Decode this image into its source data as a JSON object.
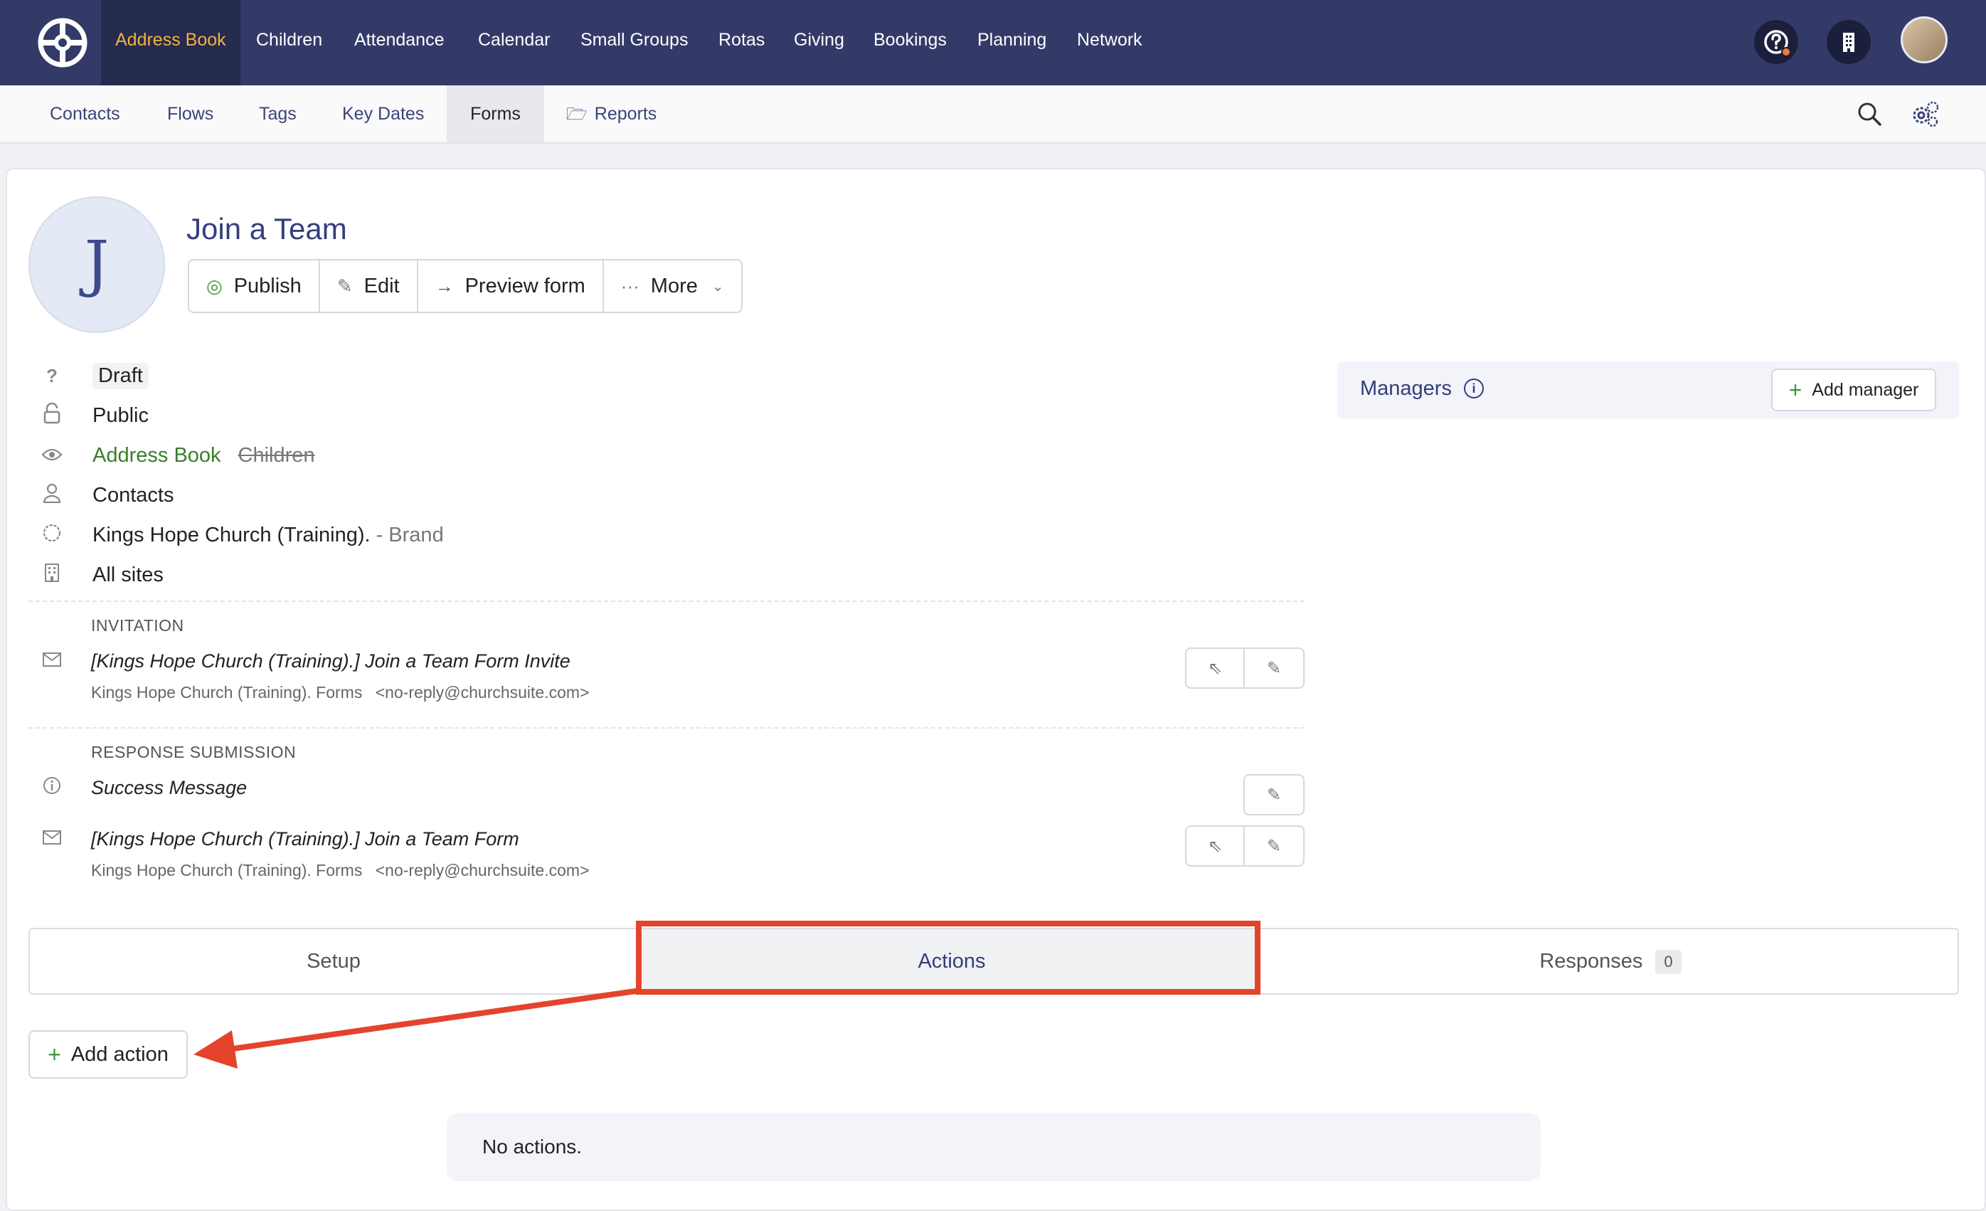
{
  "topnav": {
    "items": [
      "Address Book",
      "Children",
      "Attendance",
      "Calendar",
      "Small Groups",
      "Rotas",
      "Giving",
      "Bookings",
      "Planning",
      "Network"
    ]
  },
  "subnav": {
    "items": [
      "Contacts",
      "Flows",
      "Tags",
      "Key Dates",
      "Forms",
      "Reports"
    ]
  },
  "form": {
    "avatar_letter": "J",
    "title": "Join a Team",
    "buttons": {
      "publish": "Publish",
      "edit": "Edit",
      "preview": "Preview form",
      "more": "More"
    },
    "status": "Draft",
    "visibility": "Public",
    "modules": {
      "enabled": "Address Book",
      "disabled": "Children"
    },
    "audience": "Contacts",
    "brand_name": "Kings Hope Church (Training).",
    "brand_suffix": "- Brand",
    "sites": "All sites"
  },
  "invitation": {
    "label": "INVITATION",
    "subject": "[Kings Hope Church (Training).] Join a Team Form Invite",
    "from_name": "Kings Hope Church (Training). Forms",
    "from_email": "<no-reply@churchsuite.com>"
  },
  "response": {
    "label": "RESPONSE SUBMISSION",
    "success": "Success Message",
    "subject": "[Kings Hope Church (Training).] Join a Team Form",
    "from_name": "Kings Hope Church (Training). Forms",
    "from_email": "<no-reply@churchsuite.com>"
  },
  "managers": {
    "label": "Managers",
    "add": "Add manager"
  },
  "tabs": {
    "setup": "Setup",
    "actions": "Actions",
    "responses": "Responses",
    "responses_count": "0"
  },
  "actions": {
    "add": "Add action",
    "empty": "No actions."
  },
  "colors": {
    "topbar": "#343a68",
    "active_nav": "#f3b33d",
    "highlight": "#e5432c",
    "plus": "#3d9a3d"
  }
}
